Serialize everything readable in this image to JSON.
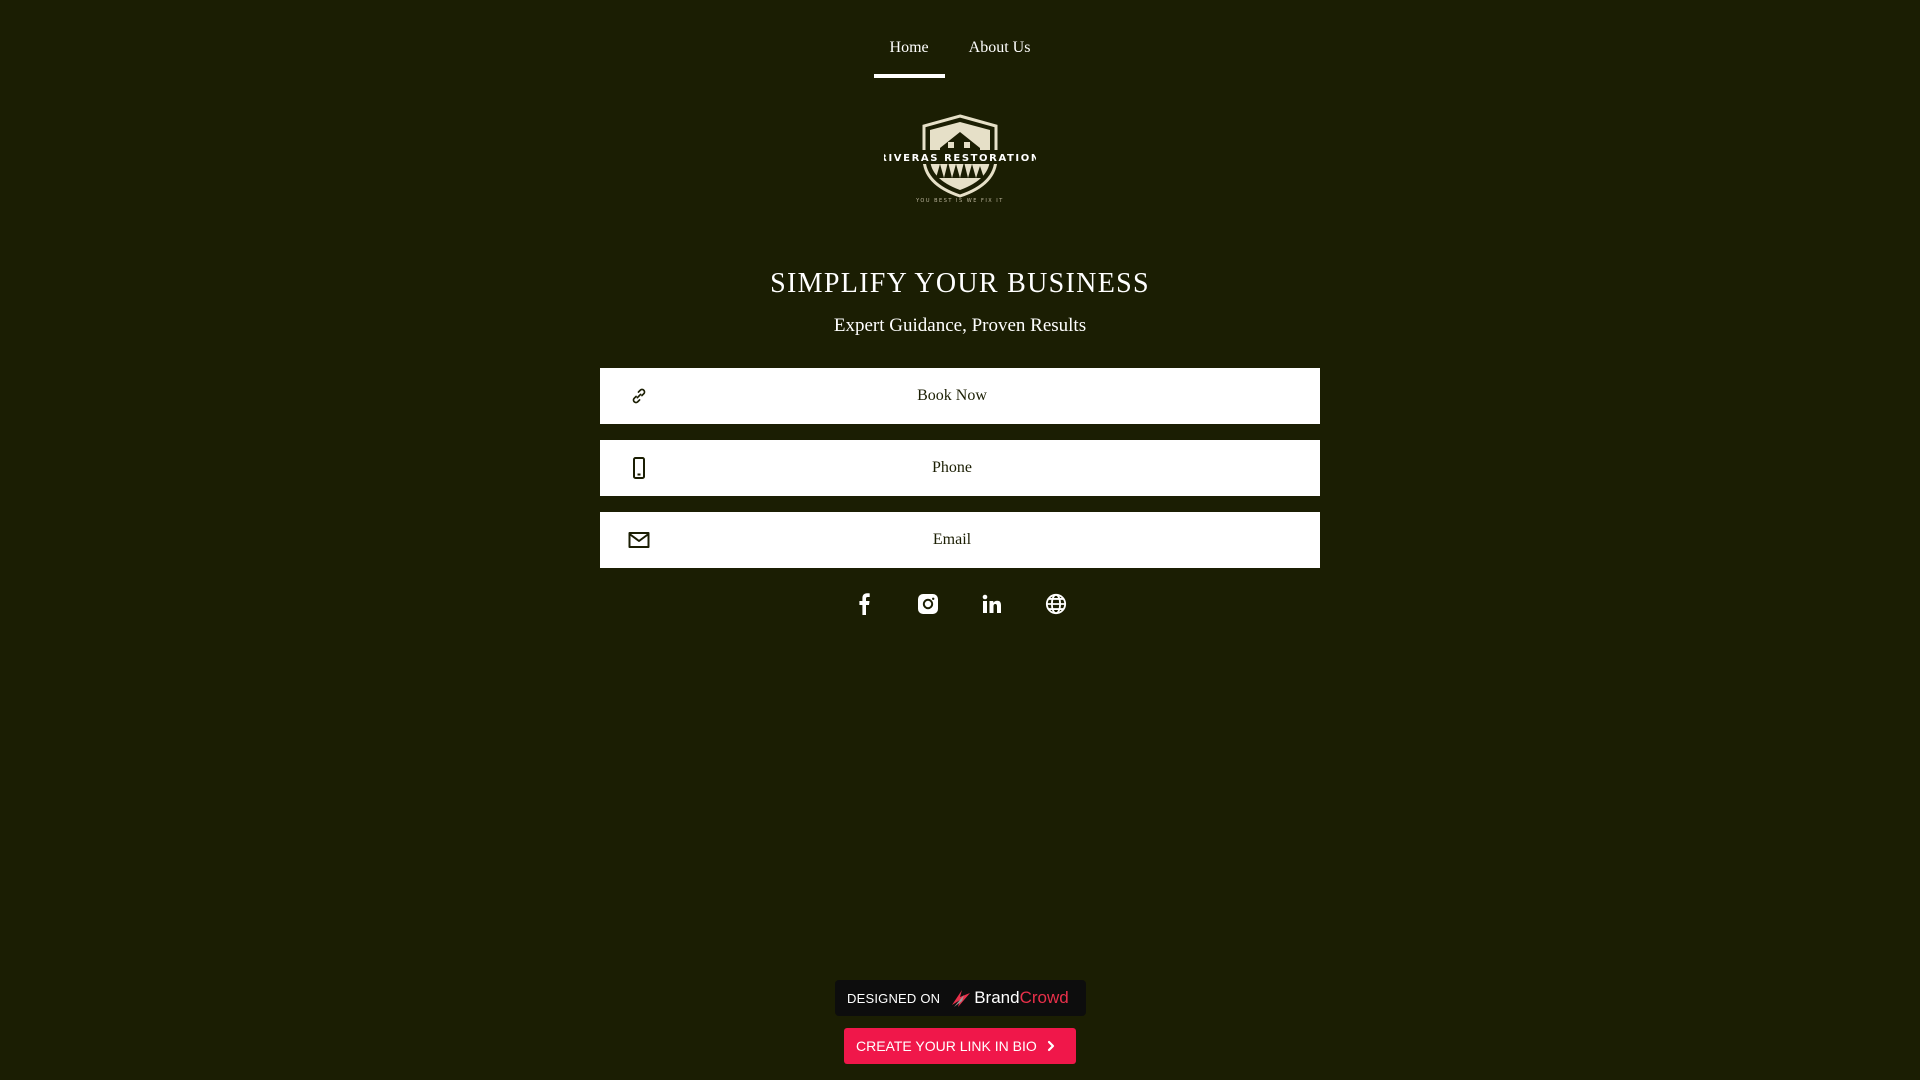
{
  "nav": {
    "items": [
      {
        "label": "Home",
        "active": true
      },
      {
        "label": "About Us",
        "active": false
      }
    ]
  },
  "logo": {
    "name": "RIVERAS RESTORATION",
    "tagline": "YOU BEST IS WE FIX IT",
    "icon": "house-shield-logo"
  },
  "hero": {
    "title": "SIMPLIFY YOUR BUSINESS",
    "subtitle": "Expert Guidance, Proven Results"
  },
  "links": [
    {
      "label": "Book Now",
      "icon": "link-icon"
    },
    {
      "label": "Phone",
      "icon": "phone-icon"
    },
    {
      "label": "Email",
      "icon": "mail-icon"
    }
  ],
  "socials": [
    {
      "icon": "facebook-icon"
    },
    {
      "icon": "instagram-icon"
    },
    {
      "icon": "linkedin-icon"
    },
    {
      "icon": "globe-icon"
    }
  ],
  "footer": {
    "designed_on": "DESIGNED ON",
    "brand_part1": "Brand",
    "brand_part2": "Crowd",
    "cta_label": "CREATE YOUR LINK IN BIO"
  },
  "colors": {
    "background": "#1b1e03",
    "button_bg": "#ffffff",
    "cta": "#f0174a",
    "brand_accent": "#e8304a"
  }
}
